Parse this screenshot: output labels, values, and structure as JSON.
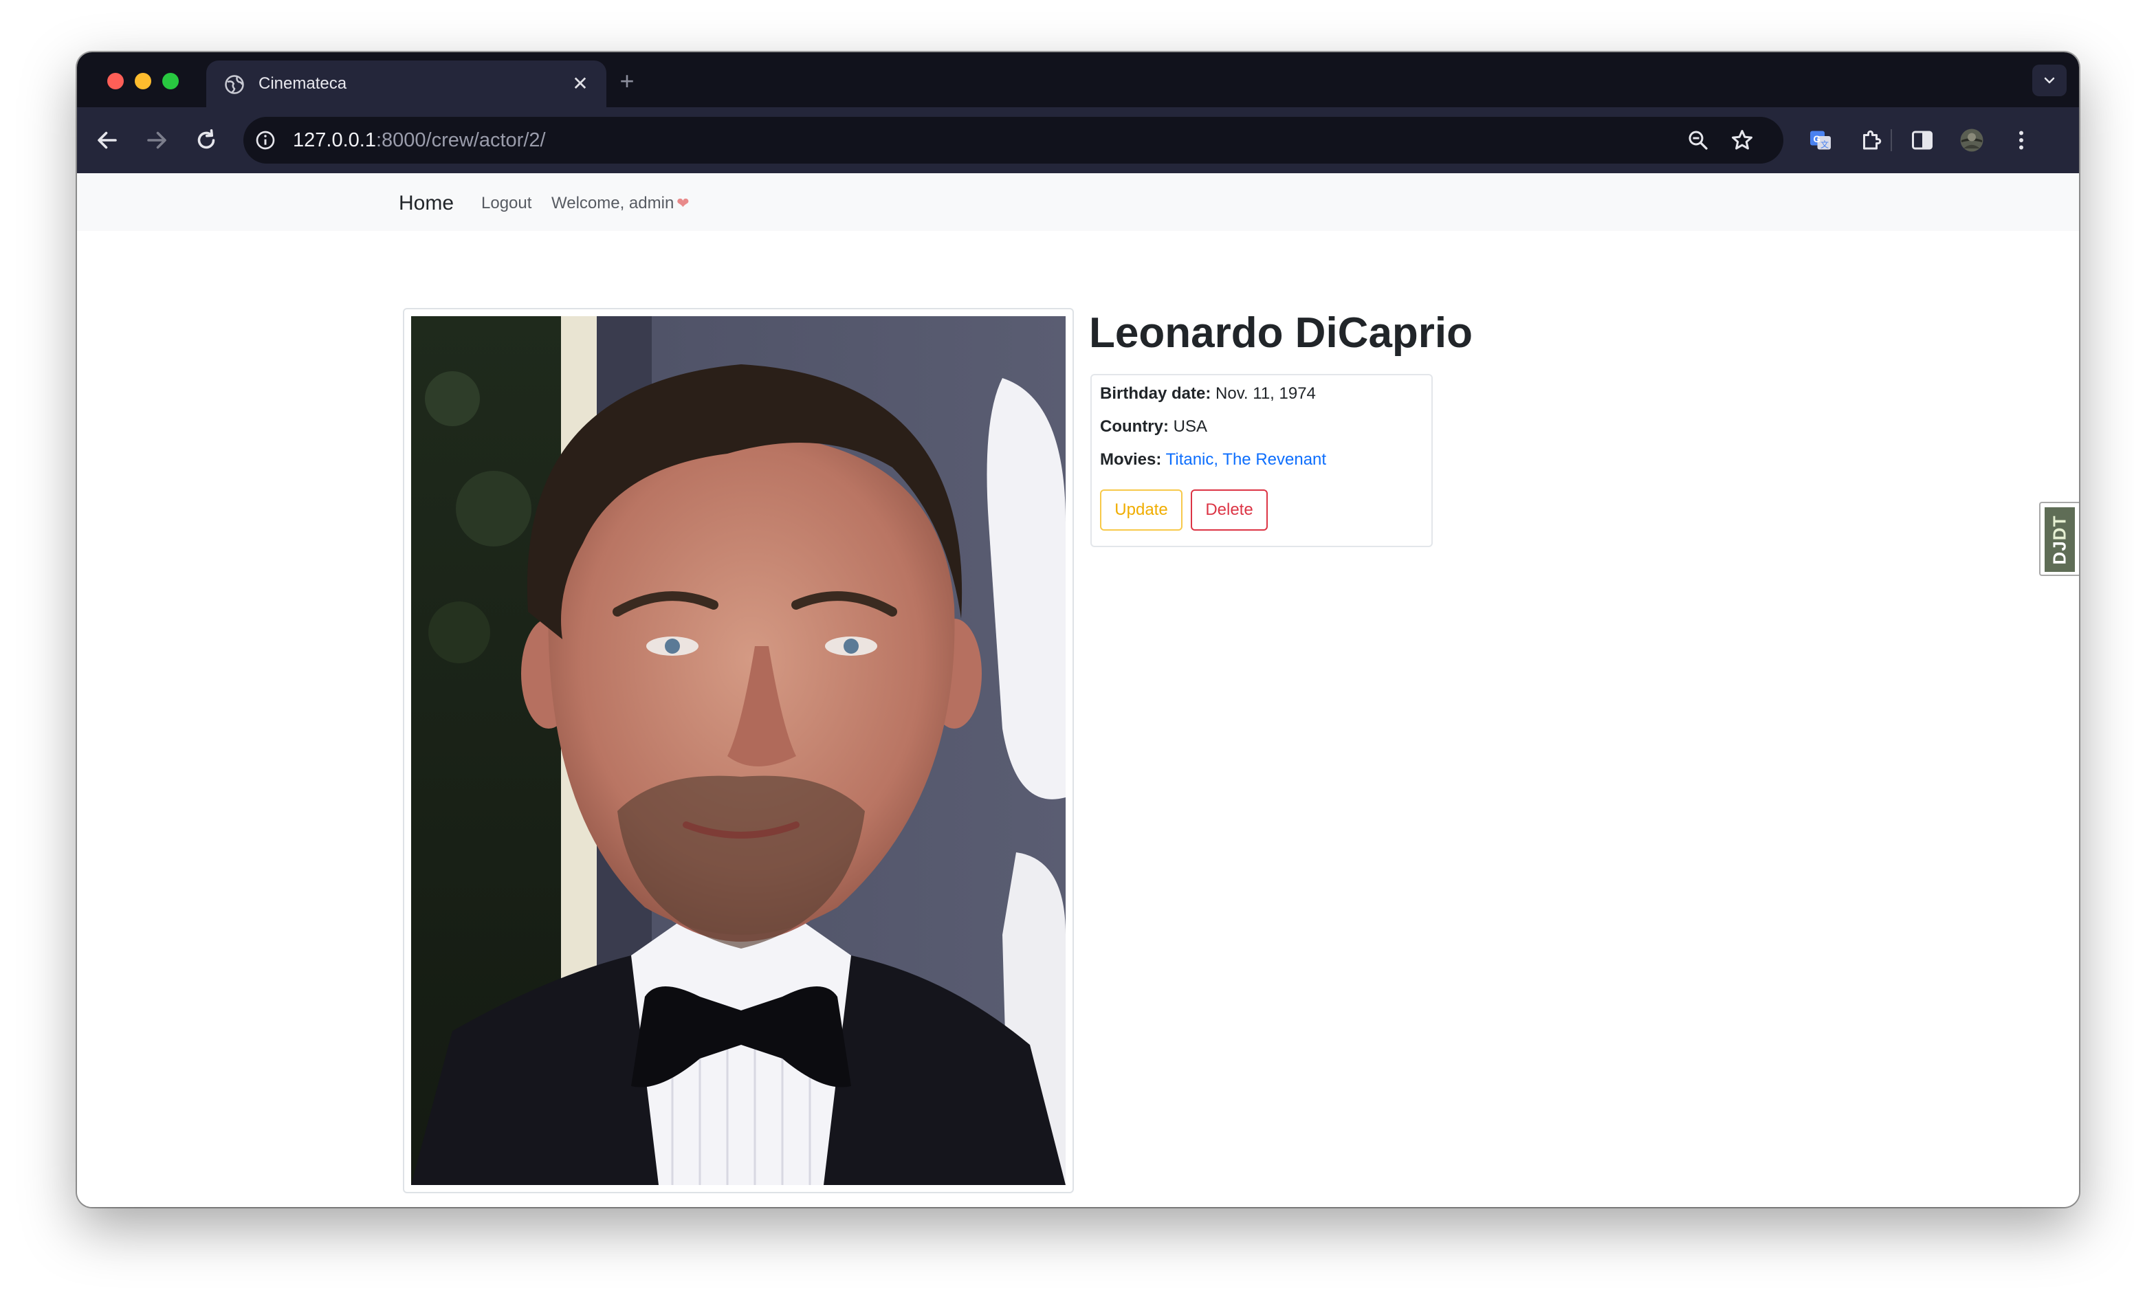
{
  "browser": {
    "tab_title": "Cinemateca",
    "tab_close": "✕",
    "new_tab": "+",
    "url_host": "127.0.0.1",
    "url_rest": ":8000/crew/actor/2/"
  },
  "navbar": {
    "brand": "Home",
    "logout": "Logout",
    "welcome": "Welcome, admin",
    "heart": "❤"
  },
  "actor": {
    "name": "Leonardo DiCaprio",
    "birthday_label": "Birthday date:",
    "birthday_value": "Nov. 11, 1974",
    "country_label": "Country:",
    "country_value": "USA",
    "movies_label": "Movies:",
    "movies": [
      "Titanic",
      "The Revenant"
    ],
    "movies_separator": ", ",
    "update_label": "Update",
    "delete_label": "Delete"
  },
  "toolbar_badge": {
    "dj": "DJ",
    "dt": "DT"
  },
  "colors": {
    "tabstrip": "#11121c",
    "toolbar": "#24263a",
    "navbar_bg": "#f8f9fa",
    "link": "#0d6efd",
    "warning": "#f0ad00",
    "danger": "#dc3545"
  },
  "icons": {
    "back": "back-arrow-icon",
    "forward": "forward-arrow-icon",
    "reload": "reload-icon",
    "info": "site-info-icon",
    "zoom": "zoom-icon",
    "bookmark": "star-icon",
    "translate": "translate-icon",
    "extensions": "puzzle-icon",
    "sidepanel": "side-panel-icon",
    "profile": "profile-avatar-icon",
    "menu": "kebab-menu-icon"
  }
}
